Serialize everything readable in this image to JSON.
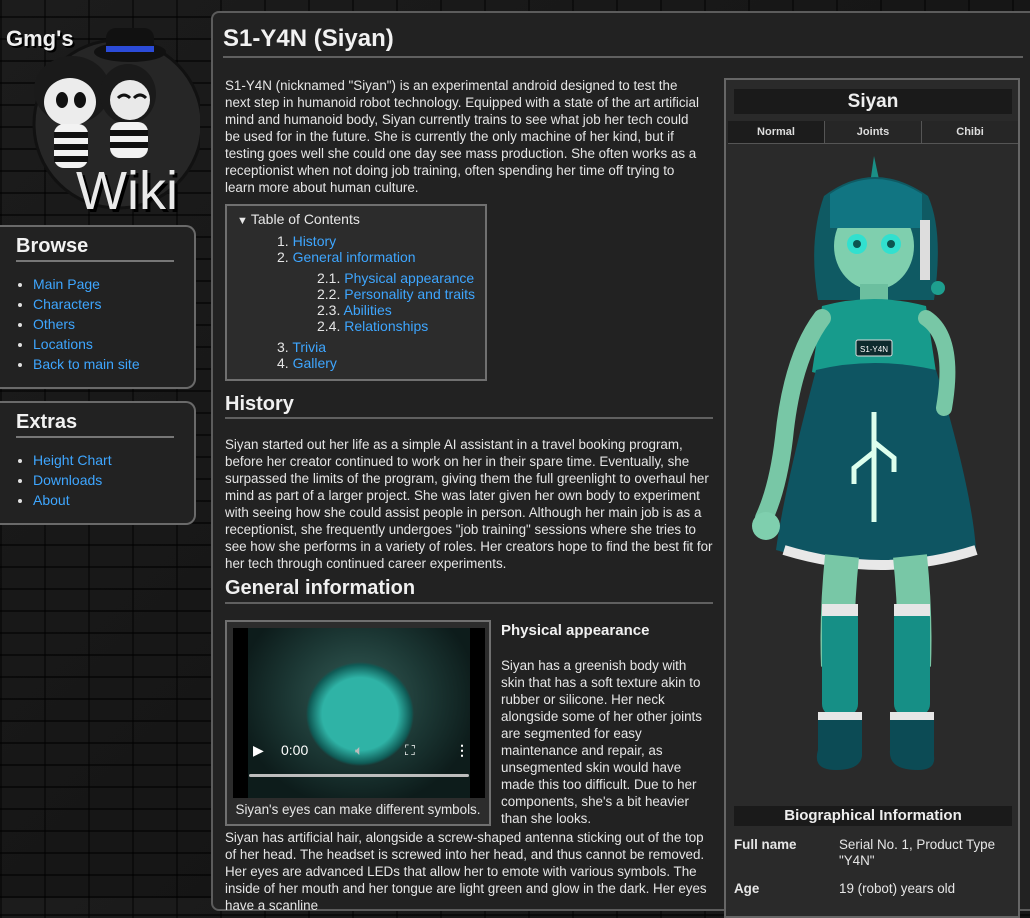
{
  "logo": {
    "top_text": "Gmg's",
    "main_text": "Wiki"
  },
  "sidebar": {
    "browse": {
      "title": "Browse",
      "items": [
        {
          "label": "Main Page"
        },
        {
          "label": "Characters"
        },
        {
          "label": "Others"
        },
        {
          "label": "Locations"
        },
        {
          "label": "Back to main site"
        }
      ]
    },
    "extras": {
      "title": "Extras",
      "items": [
        {
          "label": "Height Chart"
        },
        {
          "label": "Downloads"
        },
        {
          "label": "About"
        }
      ]
    }
  },
  "article": {
    "title": "S1-Y4N (Siyan)",
    "intro": "S1-Y4N (nicknamed \"Siyan\") is an experimental android designed to test the next step in humanoid robot technology. Equipped with a state of the art artificial mind and humanoid body, Siyan currently trains to see what job her tech could be used for in the future. She is currently the only machine of her kind, but if testing goes well she could one day see mass production. She often works as a receptionist when not doing job training, often spending her time off trying to learn more about human culture.",
    "toc": {
      "title": "Table of Contents",
      "toggle_icon": "triangle-down",
      "items": [
        {
          "num": "1.",
          "label": "History"
        },
        {
          "num": "2.",
          "label": "General information"
        },
        {
          "num": "2.1.",
          "label": "Physical appearance"
        },
        {
          "num": "2.2.",
          "label": "Personality and traits"
        },
        {
          "num": "2.3.",
          "label": "Abilities"
        },
        {
          "num": "2.4.",
          "label": "Relationships"
        },
        {
          "num": "3.",
          "label": "Trivia"
        },
        {
          "num": "4.",
          "label": "Gallery"
        }
      ]
    },
    "history": {
      "heading": "History",
      "text": "Siyan started out her life as a simple AI assistant in a travel booking program, before her creator continued to work on her in their spare time. Eventually, she surpassed the limits of the program, giving them the full greenlight to overhaul her mind as part of a larger project. She was later given her own body to experiment with seeing how she could assist people in person. Although her main job is as a receptionist, she frequently undergoes \"job training\" sessions where she tries to see how she performs in a variety of roles. Her creators hope to find the best fit for her tech through continued career experiments."
    },
    "general": {
      "heading": "General information",
      "video": {
        "time": "0:00",
        "progress": 0,
        "caption": "Siyan's eyes can make different symbols."
      },
      "physical": {
        "heading": "Physical appearance",
        "p1": "Siyan has a greenish body with skin that has a soft texture akin to rubber or silicone. Her neck alongside some of her other joints are segmented for easy maintenance and repair, as unsegmented skin would have made this too difficult. Due to her components, she's a bit heavier than she looks.",
        "p2": "Siyan has artificial hair, alongside a screw-shaped antenna sticking out of the top of her head. The headset is screwed into her head, and thus cannot be removed. Her eyes are advanced LEDs that allow her to emote with various symbols. The inside of her mouth and her tongue are light green and glow in the dark. Her eyes have a scanline"
      }
    }
  },
  "infobox": {
    "name": "Siyan",
    "tabs": [
      {
        "label": "Normal"
      },
      {
        "label": "Joints"
      },
      {
        "label": "Chibi"
      }
    ],
    "active_tab": "Normal",
    "badge_text": "S1-Y4N",
    "bio_title": "Biographical Information",
    "bio": [
      {
        "label": "Full name",
        "value": "Serial No. 1, Product Type \"Y4N\""
      },
      {
        "label": "Age",
        "value": "19 (robot) years old"
      }
    ]
  },
  "colors": {
    "link": "#3ea6ff",
    "panel": "#222222",
    "accent_teal": "#1fa596"
  }
}
